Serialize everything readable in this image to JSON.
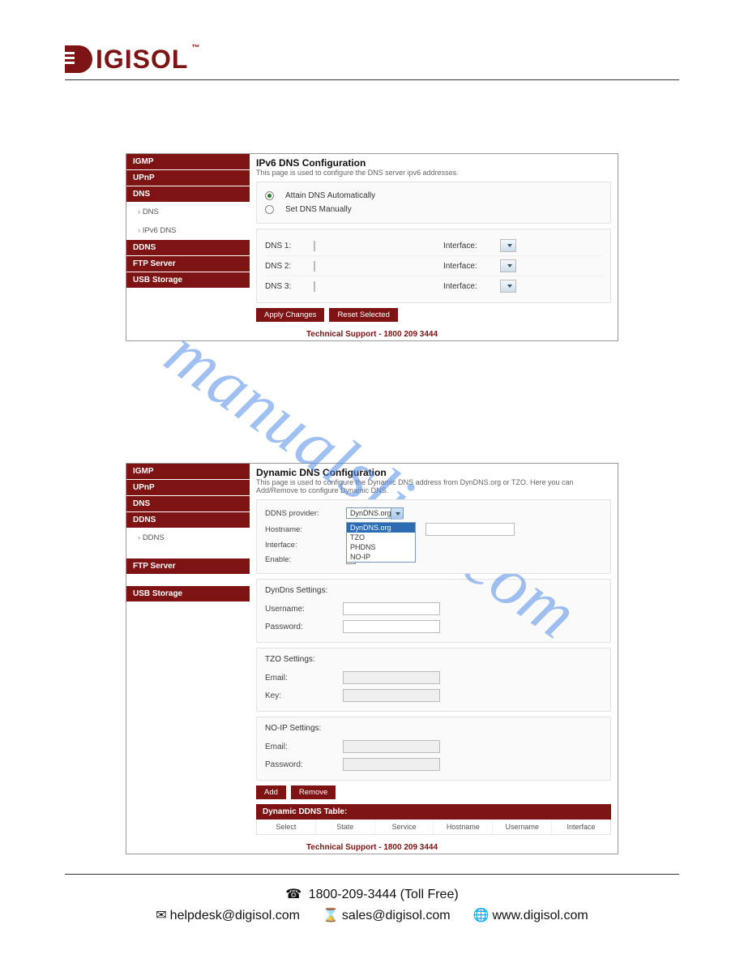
{
  "brand": {
    "name": "IGISOL",
    "tm": "™"
  },
  "watermark": "manualslive.com",
  "shot1": {
    "sidebar": {
      "items": [
        {
          "label": "IGMP",
          "type": "head"
        },
        {
          "label": "UPnP",
          "type": "head"
        },
        {
          "label": "DNS",
          "type": "head"
        },
        {
          "label": "DNS",
          "type": "item"
        },
        {
          "label": "IPv6 DNS",
          "type": "item"
        },
        {
          "label": "DDNS",
          "type": "head"
        },
        {
          "label": "FTP Server",
          "type": "head"
        },
        {
          "label": "USB Storage",
          "type": "head"
        }
      ]
    },
    "title": "IPv6 DNS Configuration",
    "desc": "This page is used to configure the DNS server ipv6 addresses.",
    "radio1": "Attain DNS Automatically",
    "radio2": "Set DNS Manually",
    "rows": [
      {
        "label": "DNS 1:",
        "iface": "Interface:"
      },
      {
        "label": "DNS 2:",
        "iface": "Interface:"
      },
      {
        "label": "DNS 3:",
        "iface": "Interface:"
      }
    ],
    "btn_apply": "Apply Changes",
    "btn_reset": "Reset Selected",
    "support": "Technical Support - 1800 209 3444"
  },
  "shot2": {
    "sidebar": {
      "items": [
        {
          "label": "IGMP",
          "type": "head"
        },
        {
          "label": "UPnP",
          "type": "head"
        },
        {
          "label": "DNS",
          "type": "head"
        },
        {
          "label": "DDNS",
          "type": "head"
        },
        {
          "label": "DDNS",
          "type": "item"
        },
        {
          "label": "FTP Server",
          "type": "head"
        },
        {
          "label": "USB Storage",
          "type": "head"
        }
      ]
    },
    "title": "Dynamic DNS Configuration",
    "desc": "This page is used to configure the Dynamic DNS address from DynDNS.org or TZO. Here you can Add/Remove to configure Dynamic DNS.",
    "provider_label": "DDNS provider:",
    "provider_value": "DynDNS.org",
    "provider_options": [
      "DynDNS.org",
      "TZO",
      "PHDNS",
      "NO-IP"
    ],
    "hostname_label": "Hostname:",
    "interface_label": "Interface:",
    "enable_label": "Enable:",
    "dyndns_heading": "DynDns Settings:",
    "username_label": "Username:",
    "password_label": "Password:",
    "tzo_heading": "TZO Settings:",
    "email_label": "Email:",
    "key_label": "Key:",
    "noip_heading": "NO-IP Settings:",
    "noip_email_label": "Email:",
    "noip_pass_label": "Password:",
    "btn_add": "Add",
    "btn_remove": "Remove",
    "table_title": "Dynamic DDNS Table:",
    "table_cols": [
      "Select",
      "State",
      "Service",
      "Hostname",
      "Username",
      "Interface"
    ],
    "support": "Technical Support - 1800 209 3444"
  },
  "footer": {
    "phone": "1800-209-3444 (Toll Free)",
    "email": "helpdesk@digisol.com",
    "sales": "sales@digisol.com",
    "web": "www.digisol.com"
  }
}
